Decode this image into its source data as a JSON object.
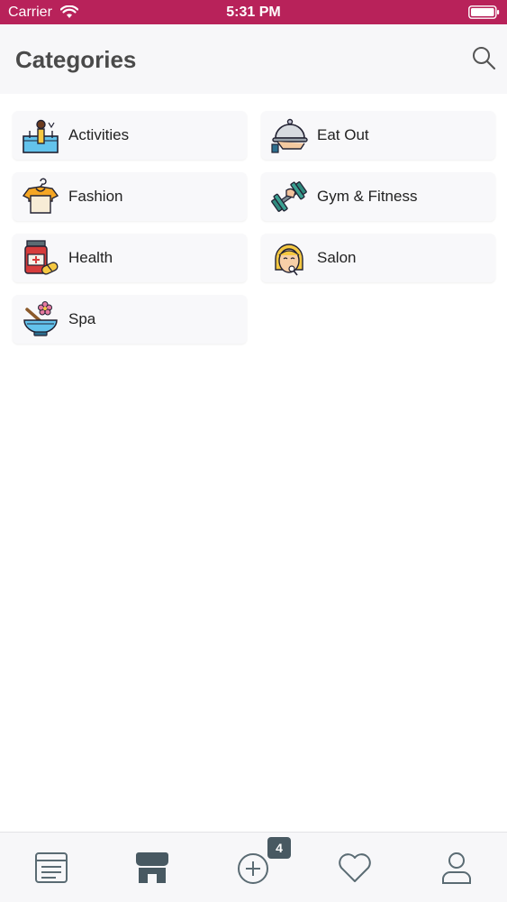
{
  "status_bar": {
    "carrier": "Carrier",
    "time": "5:31 PM"
  },
  "header": {
    "title": "Categories",
    "search_icon": "search-icon"
  },
  "categories": [
    {
      "label": "Activities",
      "icon": "activities-icon"
    },
    {
      "label": "Eat Out",
      "icon": "cloche-icon"
    },
    {
      "label": "Fashion",
      "icon": "tshirt-icon"
    },
    {
      "label": "Gym & Fitness",
      "icon": "dumbbell-icon"
    },
    {
      "label": "Health",
      "icon": "medicine-icon"
    },
    {
      "label": "Salon",
      "icon": "salon-icon"
    },
    {
      "label": "Spa",
      "icon": "spa-bowl-icon"
    }
  ],
  "tab_bar": {
    "badge_count": "4",
    "tabs": [
      "feed-icon",
      "store-icon",
      "add-icon",
      "heart-icon",
      "profile-icon"
    ]
  },
  "colors": {
    "status_bar": "#b8225a",
    "tab_active": "#485962",
    "tab_inactive": "#5a6b73"
  }
}
